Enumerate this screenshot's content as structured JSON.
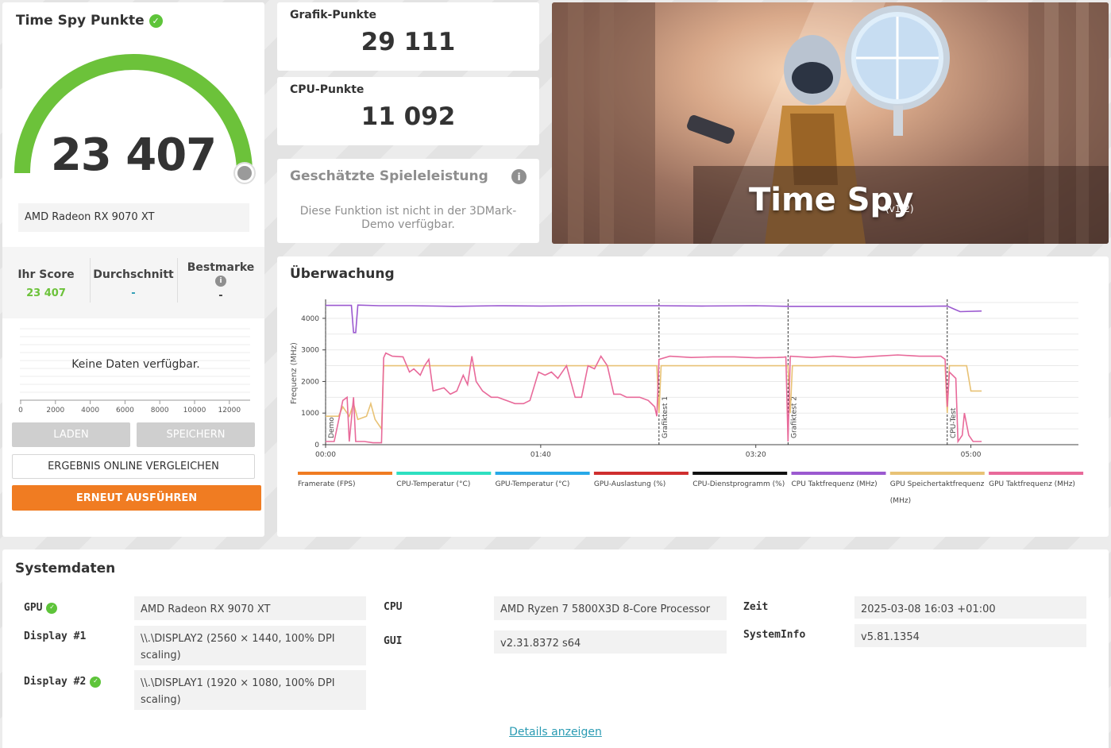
{
  "score": {
    "title": "Time Spy Punkte",
    "value": "23 407",
    "gauge_fraction": 1.0,
    "gpu": "AMD Radeon RX 9070 XT",
    "stats": {
      "your_label": "Ihr Score",
      "your_value": "23 407",
      "avg_label": "Durchschnitt",
      "avg_value": "-",
      "best_label": "Bestmarke",
      "best_value": "-"
    },
    "no_data": "Keine Daten verfügbar.",
    "mini_axis": [
      "0",
      "2000",
      "4000",
      "6000",
      "8000",
      "10000",
      "12000"
    ],
    "buttons": {
      "load": "LADEN",
      "save": "SPEICHERN",
      "compare": "ERGEBNIS ONLINE VERGLEICHEN",
      "rerun": "ERNEUT AUSFÜHREN"
    }
  },
  "graphics": {
    "label": "Grafik-Punkte",
    "value": "29 111"
  },
  "cpu": {
    "label": "CPU-Punkte",
    "value": "11 092"
  },
  "estimate": {
    "title": "Geschätzte Spieleleistung",
    "text": "Diese Funktion ist nicht in der 3DMark-Demo verfügbar."
  },
  "hero": {
    "title": "Time Spy",
    "version": "(v1.2)"
  },
  "monitoring": {
    "title": "Überwachung",
    "chart_data": {
      "type": "line",
      "ylabel": "Frequenz (MHz)",
      "ylim": [
        0,
        4500
      ],
      "yticks": [
        "0",
        "1000",
        "2000",
        "3000",
        "4000"
      ],
      "xticks": [
        "00:00",
        "01:40",
        "03:20",
        "05:00"
      ],
      "xlim_s": [
        0,
        350
      ],
      "markers": [
        {
          "label": "Demo",
          "t": 0
        },
        {
          "label": "Grafiktest 1",
          "t": 155
        },
        {
          "label": "Grafiktest 2",
          "t": 215
        },
        {
          "label": "CPU-Test",
          "t": 289
        }
      ],
      "legend": [
        {
          "name": "Framerate (FPS)",
          "color": "#f07c22"
        },
        {
          "name": "CPU-Temperatur (°C)",
          "color": "#2ee0c0"
        },
        {
          "name": "GPU-Temperatur (°C)",
          "color": "#27a9e8"
        },
        {
          "name": "GPU-Auslastung (%)",
          "color": "#cf2e2e"
        },
        {
          "name": "CPU-Dienstprogramm (%)",
          "color": "#111111"
        },
        {
          "name": "CPU Taktfrequenz (MHz)",
          "color": "#9b59d0"
        },
        {
          "name": "GPU Speichertaktfrequenz (MHz)",
          "color": "#e8c275"
        },
        {
          "name": "GPU Taktfrequenz (MHz)",
          "color": "#e86a9a"
        }
      ],
      "series": [
        {
          "name": "CPU Taktfrequenz (MHz)",
          "color": "#9b59d0",
          "points": [
            [
              0,
              4410
            ],
            [
              12,
              4410
            ],
            [
              13,
              3550
            ],
            [
              14,
              3550
            ],
            [
              15,
              4420
            ],
            [
              25,
              4400
            ],
            [
              40,
              4400
            ],
            [
              60,
              4380
            ],
            [
              80,
              4400
            ],
            [
              100,
              4390
            ],
            [
              120,
              4400
            ],
            [
              140,
              4400
            ],
            [
              155,
              4400
            ],
            [
              175,
              4390
            ],
            [
              200,
              4400
            ],
            [
              215,
              4380
            ],
            [
              235,
              4380
            ],
            [
              255,
              4380
            ],
            [
              275,
              4380
            ],
            [
              289,
              4390
            ],
            [
              292,
              4300
            ],
            [
              295,
              4210
            ],
            [
              305,
              4230
            ]
          ]
        },
        {
          "name": "GPU Speichertaktfrequenz (MHz)",
          "color": "#e8c275",
          "points": [
            [
              0,
              900
            ],
            [
              6,
              900
            ],
            [
              8,
              1200
            ],
            [
              11,
              900
            ],
            [
              13,
              1300
            ],
            [
              15,
              800
            ],
            [
              19,
              900
            ],
            [
              21,
              1300
            ],
            [
              23,
              800
            ],
            [
              26,
              500
            ],
            [
              27,
              2500
            ],
            [
              154,
              2500
            ],
            [
              155,
              1000
            ],
            [
              156,
              2500
            ],
            [
              215,
              2500
            ],
            [
              216,
              1000
            ],
            [
              217,
              2500
            ],
            [
              288,
              2500
            ],
            [
              289,
              1000
            ],
            [
              290,
              2500
            ],
            [
              298,
              2500
            ],
            [
              300,
              1700
            ],
            [
              305,
              1700
            ]
          ]
        },
        {
          "name": "GPU Taktfrequenz (MHz)",
          "color": "#e86a9a",
          "points": [
            [
              0,
              100
            ],
            [
              4,
              100
            ],
            [
              8,
              1400
            ],
            [
              10,
              1500
            ],
            [
              11,
              100
            ],
            [
              13,
              1500
            ],
            [
              14,
              100
            ],
            [
              18,
              100
            ],
            [
              22,
              60
            ],
            [
              26,
              60
            ],
            [
              27,
              2750
            ],
            [
              28,
              2900
            ],
            [
              31,
              2800
            ],
            [
              36,
              2780
            ],
            [
              39,
              2300
            ],
            [
              41,
              2400
            ],
            [
              44,
              2200
            ],
            [
              46,
              2500
            ],
            [
              48,
              2700
            ],
            [
              50,
              1700
            ],
            [
              55,
              1800
            ],
            [
              58,
              1600
            ],
            [
              61,
              1700
            ],
            [
              64,
              2200
            ],
            [
              66,
              1900
            ],
            [
              68,
              2800
            ],
            [
              70,
              2000
            ],
            [
              73,
              1700
            ],
            [
              77,
              1500
            ],
            [
              80,
              1500
            ],
            [
              84,
              1400
            ],
            [
              88,
              1300
            ],
            [
              92,
              1300
            ],
            [
              95,
              1400
            ],
            [
              99,
              2300
            ],
            [
              102,
              2200
            ],
            [
              105,
              2300
            ],
            [
              108,
              2100
            ],
            [
              112,
              2500
            ],
            [
              116,
              1500
            ],
            [
              119,
              1500
            ],
            [
              122,
              2500
            ],
            [
              125,
              2400
            ],
            [
              128,
              2800
            ],
            [
              131,
              2500
            ],
            [
              134,
              1600
            ],
            [
              137,
              1600
            ],
            [
              140,
              1500
            ],
            [
              146,
              1500
            ],
            [
              150,
              1400
            ],
            [
              153,
              1200
            ],
            [
              154,
              900
            ],
            [
              155,
              2700
            ],
            [
              160,
              2800
            ],
            [
              170,
              2760
            ],
            [
              180,
              2780
            ],
            [
              190,
              2780
            ],
            [
              200,
              2750
            ],
            [
              210,
              2760
            ],
            [
              213,
              2770
            ],
            [
              214,
              2780
            ],
            [
              215,
              100
            ],
            [
              216,
              2800
            ],
            [
              226,
              2760
            ],
            [
              236,
              2800
            ],
            [
              246,
              2760
            ],
            [
              256,
              2800
            ],
            [
              266,
              2840
            ],
            [
              276,
              2800
            ],
            [
              286,
              2800
            ],
            [
              288,
              2700
            ],
            [
              289,
              1200
            ],
            [
              290,
              2300
            ],
            [
              293,
              2100
            ],
            [
              294,
              100
            ],
            [
              296,
              300
            ],
            [
              297,
              1000
            ],
            [
              299,
              300
            ],
            [
              301,
              100
            ],
            [
              305,
              100
            ]
          ]
        }
      ]
    }
  },
  "system": {
    "title": "Systemdaten",
    "gpu_label": "GPU",
    "gpu_value": "AMD Radeon RX 9070 XT",
    "display1_label": "Display #1",
    "display1_value": "\\\\.\\DISPLAY2 (2560 × 1440, 100% DPI scaling)",
    "display2_label": "Display #2",
    "display2_value": "\\\\.\\DISPLAY1 (1920 × 1080, 100% DPI scaling)",
    "cpu_label": "CPU",
    "cpu_value": "AMD Ryzen 7 5800X3D 8-Core Processor",
    "gui_label": "GUI",
    "gui_value": "v2.31.8372 s64",
    "time_label": "Zeit",
    "time_value": "2025-03-08 16:03 +01:00",
    "sysinfo_label": "SystemInfo",
    "sysinfo_value": "v5.81.1354",
    "details_link": "Details anzeigen"
  }
}
